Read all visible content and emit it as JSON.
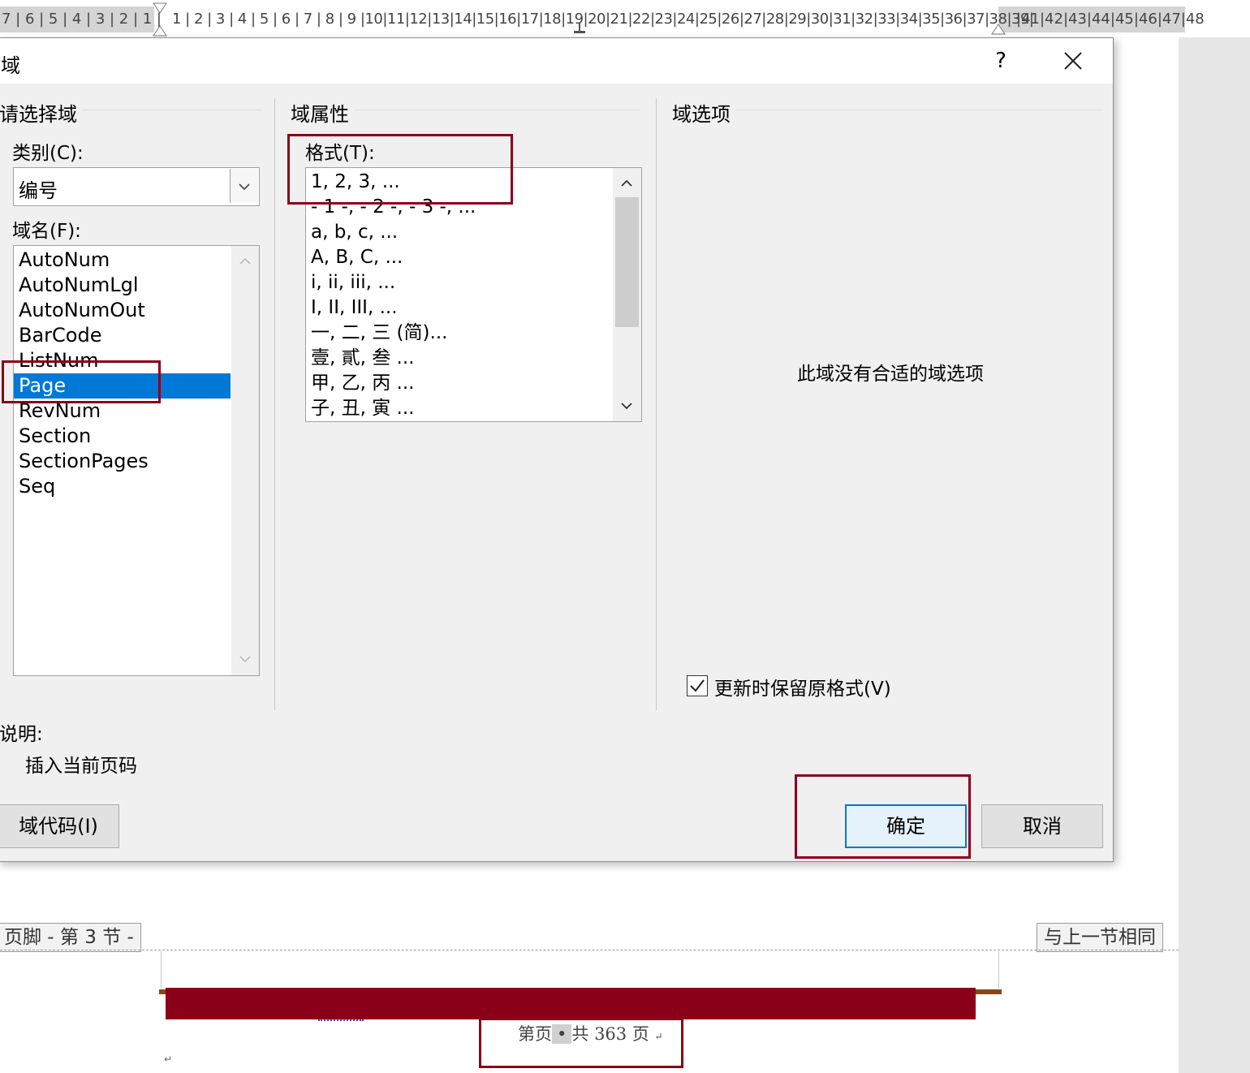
{
  "ruler": {
    "left_numbers": "7 | 6 | 5 | 4 | 3 | 2 | 1 |",
    "right_numbers": "1 | 2 | 3 | 4 | 5 | 6 | 7 | 8 | 9 |10|11|12|13|14|15|16|17|18|19|20|21|22|23|24|25|26|27|28|29|30|31|32|33|34|35|36|37|38|39|",
    "far_numbers": "|41|42|43|44|45|46|47|48"
  },
  "dialog": {
    "title": "域",
    "help": "?",
    "left": {
      "section_title": "请选择域",
      "category_label": "类别(C):",
      "category_value": "编号",
      "fieldname_label": "域名(F):",
      "fields": [
        "AutoNum",
        "AutoNumLgl",
        "AutoNumOut",
        "BarCode",
        "ListNum",
        "Page",
        "RevNum",
        "Section",
        "SectionPages",
        "Seq"
      ],
      "selected_field": "Page"
    },
    "middle": {
      "section_title": "域属性",
      "format_label": "格式(T):",
      "formats": [
        "1, 2, 3, ...",
        "- 1 -, - 2 -, - 3 -, ...",
        "a, b, c, ...",
        "A, B, C, ...",
        "i, ii, iii, ...",
        "I, II, III, ...",
        "一, 二, 三 (简)...",
        "壹, 貳, 叁 ...",
        "甲, 乙, 丙 ...",
        "子, 丑, 寅 ..."
      ]
    },
    "right": {
      "section_title": "域选项",
      "no_options_text": "此域没有合适的域选项",
      "preserve_format_label": "更新时保留原格式(V)",
      "preserve_format_checked": true
    },
    "description_label": "说明:",
    "description_text": "插入当前页码",
    "field_codes_button": "域代码(I)",
    "ok_button": "确定",
    "cancel_button": "取消"
  },
  "document": {
    "footer_tab": "页脚 - 第 3 节 -",
    "same_as_previous": "与上一节相同",
    "footer_text_prefix": "第页",
    "footer_field_marker": "•",
    "footer_text_suffix": "共 363 页",
    "paragraph_mark": "↵",
    "colors": {
      "banner": "#8b0019",
      "highlight_box": "#8b0019",
      "selection": "#0078d7"
    }
  }
}
